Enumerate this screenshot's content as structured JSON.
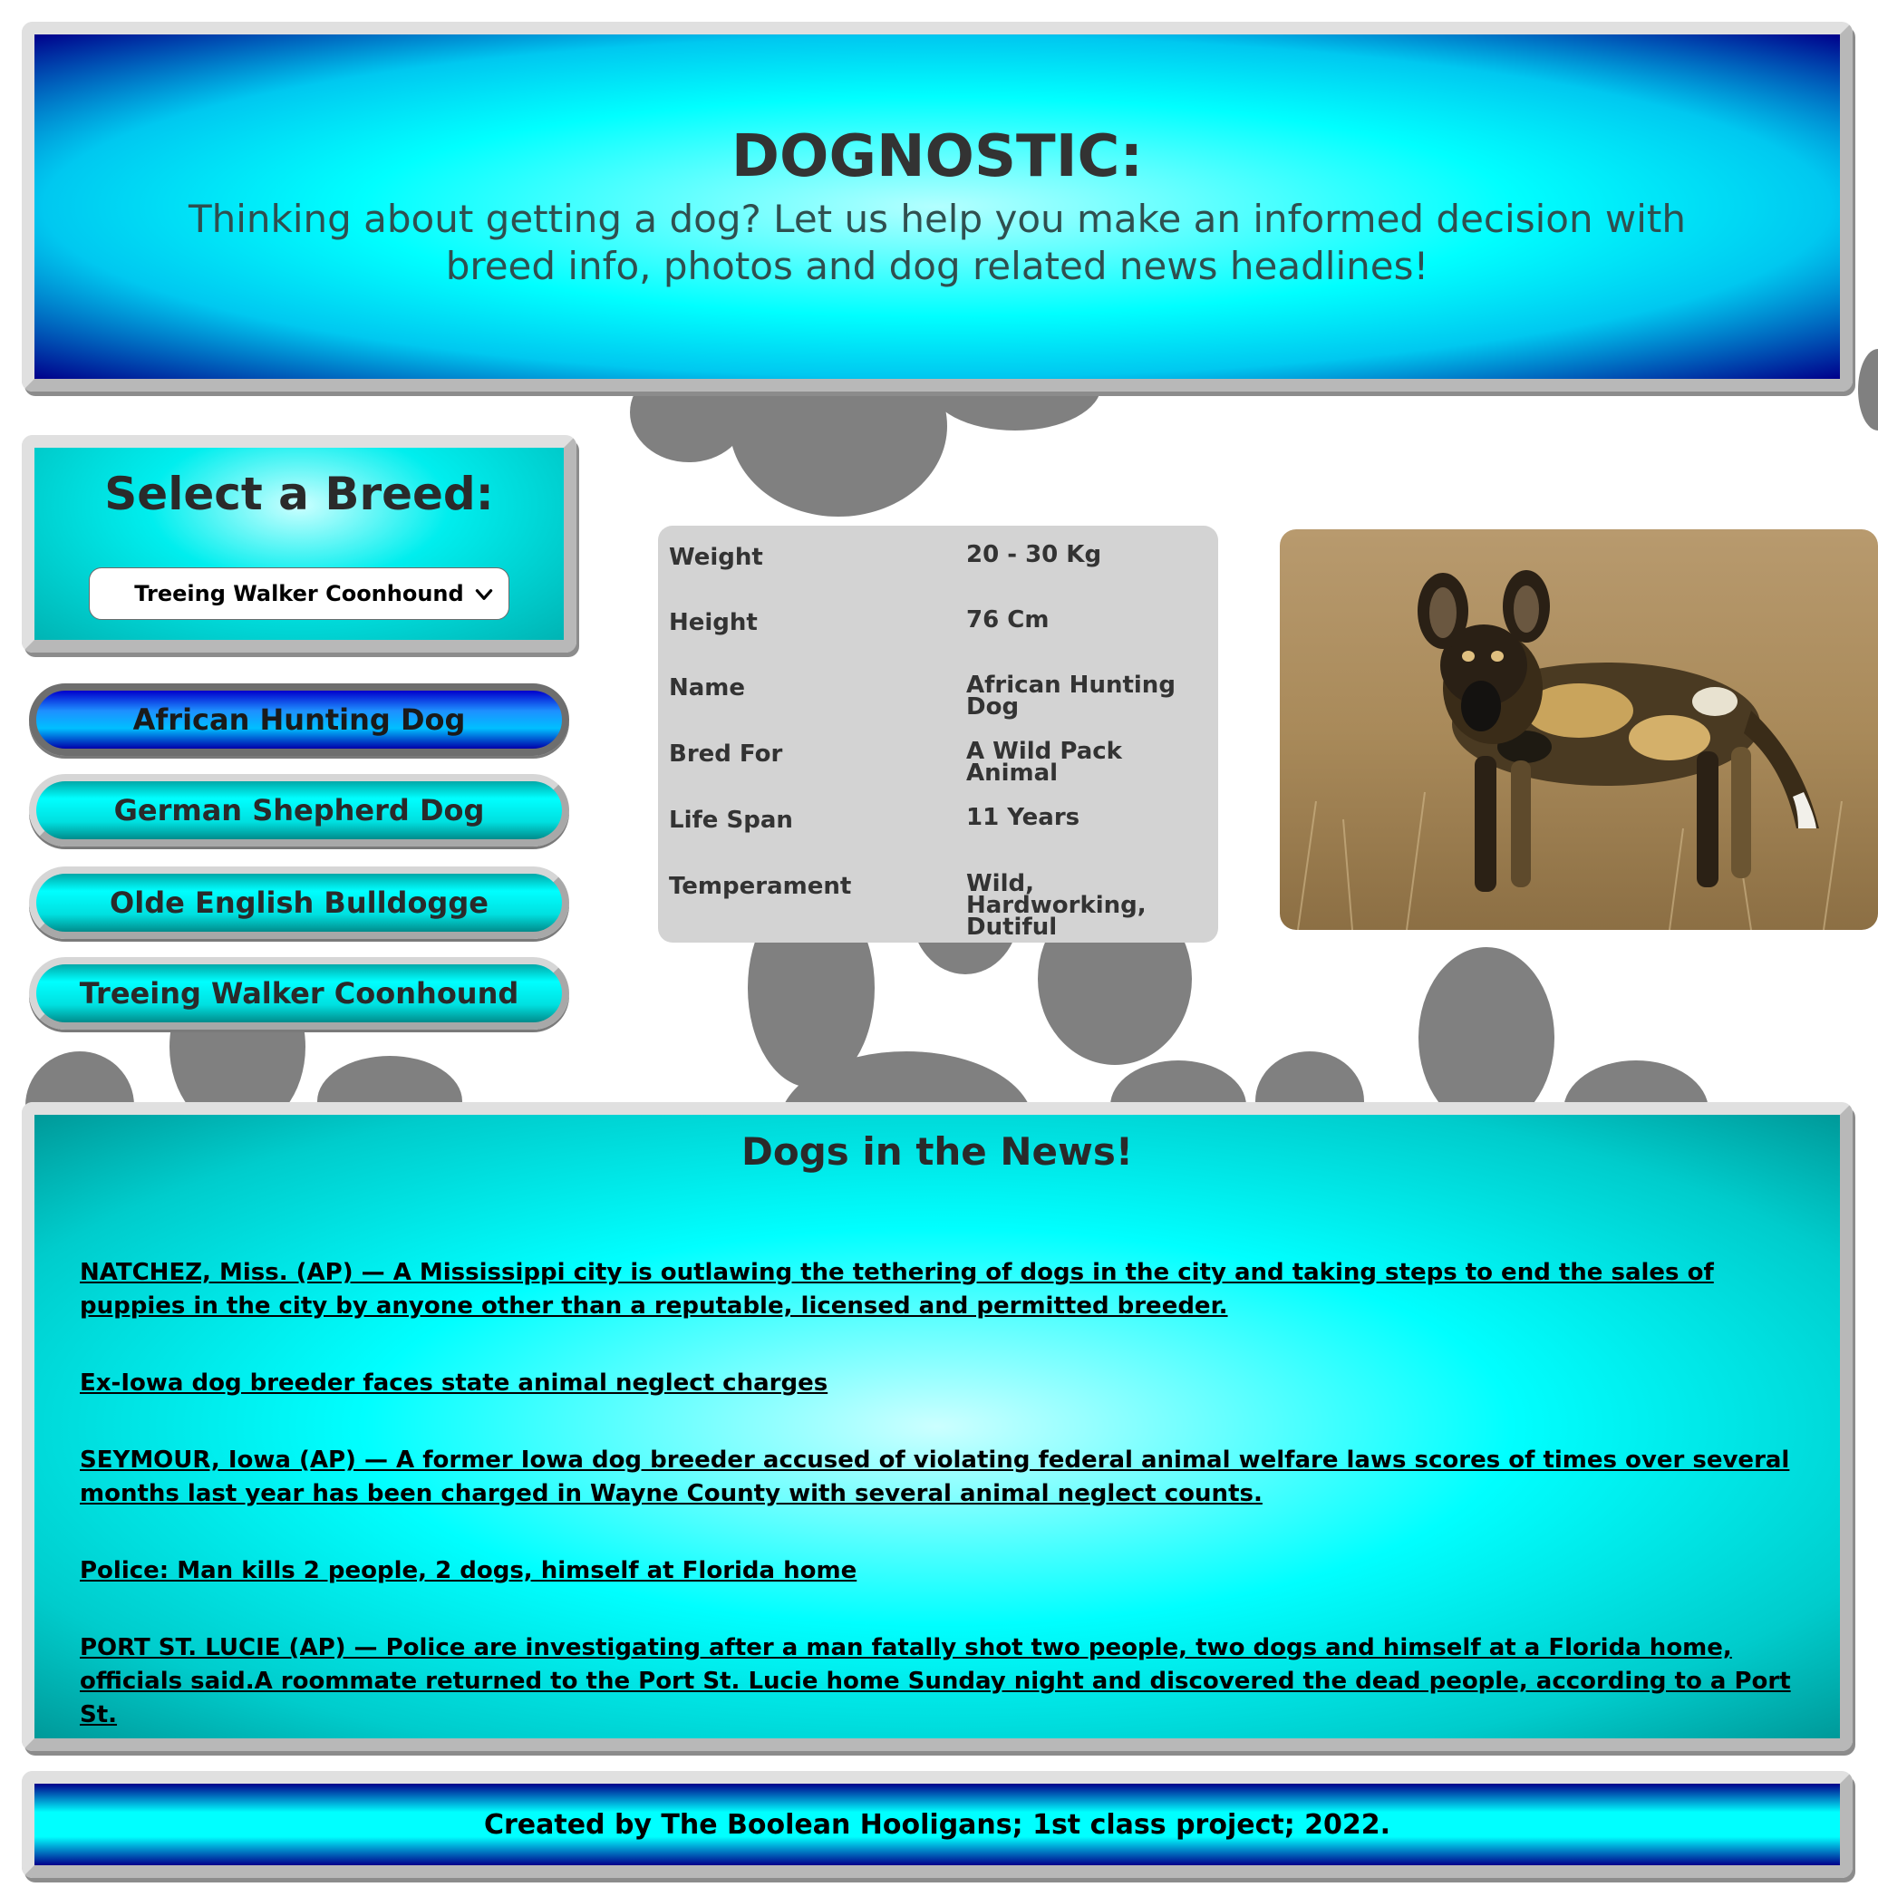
{
  "header": {
    "title": "DOGNOSTIC:",
    "subtitle": "Thinking about getting a dog? Let us help you make an informed decision with breed info, photos and dog related news headlines!"
  },
  "breed_select": {
    "heading": "Select a Breed:",
    "selected": "Treeing Walker Coonhound"
  },
  "breed_buttons": [
    {
      "label": "African Hunting Dog",
      "active": true
    },
    {
      "label": "German Shepherd Dog",
      "active": false
    },
    {
      "label": "Olde English Bulldogge",
      "active": false
    },
    {
      "label": "Treeing Walker Coonhound",
      "active": false
    }
  ],
  "breed_info": [
    {
      "key": "Weight",
      "value": "20 - 30 Kg"
    },
    {
      "key": "Height",
      "value": "76 Cm"
    },
    {
      "key": "Name",
      "value": "African Hunting Dog"
    },
    {
      "key": "Bred For",
      "value": "A Wild Pack Animal"
    },
    {
      "key": "Life Span",
      "value": "11 Years"
    },
    {
      "key": "Temperament",
      "value": "Wild, Hardworking, Dutiful"
    }
  ],
  "news": {
    "heading": "Dogs in the News!",
    "items": [
      "NATCHEZ, Miss. (AP) — A Mississippi city is outlawing the tethering of dogs in the city and taking steps to end the sales of puppies in the city by anyone other than a reputable, licensed and permitted breeder.",
      "Ex-Iowa dog breeder faces state animal neglect charges",
      "SEYMOUR, Iowa (AP) — A former Iowa dog breeder accused of violating federal animal welfare laws scores of times over several months last year has been charged in Wayne County with several animal neglect counts.",
      "Police: Man kills 2 people, 2 dogs, himself at Florida home",
      "PORT ST. LUCIE (AP) — Police are investigating after a man fatally shot two people, two dogs and himself at a Florida home, officials said.A roommate returned to the Port St. Lucie home Sunday night and discovered the dead people, according to a Port St."
    ]
  },
  "footer": {
    "text": "Created by The Boolean Hooligans; 1st class project; 2022."
  }
}
